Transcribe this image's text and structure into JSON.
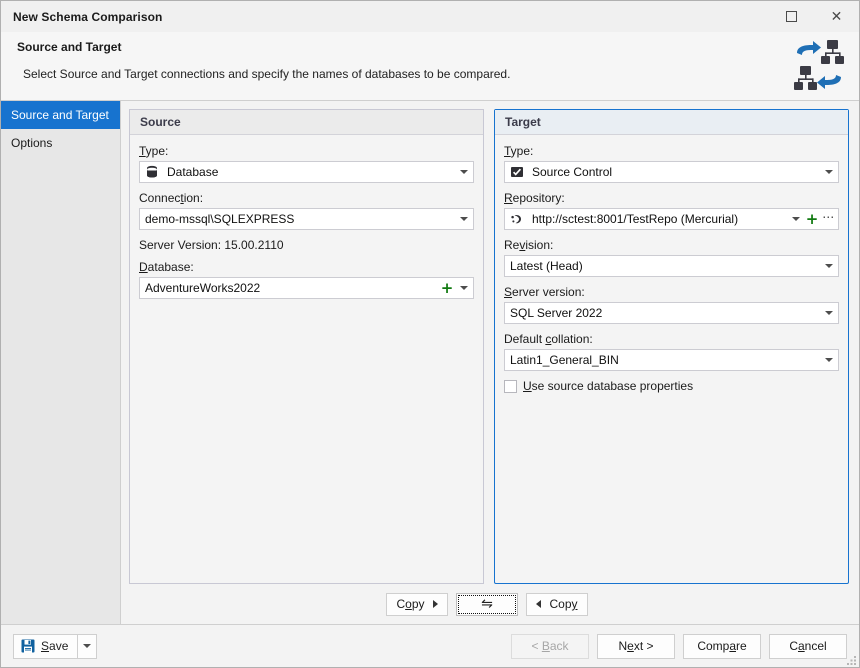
{
  "window": {
    "title": "New Schema Comparison",
    "maximize_icon": "maximize-square-icon",
    "close_icon": "close-x-icon",
    "close_glyph": "✕"
  },
  "header": {
    "title": "Source and Target",
    "description": "Select Source and Target connections and specify the names of databases to be compared.",
    "logo_icon": "schema-comparison-logo-icon"
  },
  "sidebar": {
    "items": [
      {
        "label": "Source and Target",
        "active": true
      },
      {
        "label": "Options",
        "active": false
      }
    ]
  },
  "source_panel": {
    "title": "Source",
    "type": {
      "label": "Type:",
      "label_pre": "T",
      "label_post": "ype:",
      "value": "Database",
      "icon": "database-cylinder-icon"
    },
    "connection": {
      "label_pre": "Connec",
      "label_mid": "t",
      "label_post": "ion:",
      "value": "demo-mssql\\SQLEXPRESS"
    },
    "server_version": "Server Version: 15.00.2110",
    "database": {
      "label_pre": "D",
      "label_mid": "a",
      "label_post": "tabase:",
      "value": "AdventureWorks2022",
      "add_glyph": "+"
    }
  },
  "target_panel": {
    "title": "Target",
    "type": {
      "label_pre": "T",
      "label_post": "ype:",
      "value": "Source Control",
      "icon": "source-control-check-icon"
    },
    "repository": {
      "label_pre": "R",
      "label_post": "epository:",
      "value": "http://sctest:8001/TestRepo (Mercurial)",
      "icon": "mercurial-repo-icon",
      "add_glyph": "+",
      "more_glyph": "⋯"
    },
    "revision": {
      "label_pre": "Re",
      "label_mid": "v",
      "label_post": "ision:",
      "value": "Latest (Head)"
    },
    "server_version": {
      "label_pre": "S",
      "label_post": "erver version:",
      "value": "SQL Server 2022"
    },
    "default_collation": {
      "label_pre": "Default ",
      "label_mid": "c",
      "label_post": "ollation:",
      "value": "Latin1_General_BIN"
    },
    "use_source_db_props": {
      "label_pre": "U",
      "label_post": "se source database properties",
      "checked": false
    }
  },
  "copy_row": {
    "copy_right": {
      "label_pre": "C",
      "label_mid": "o",
      "label_post": "py",
      "arrow": "triangle-right"
    },
    "swap": {
      "glyph": "⇋",
      "icon": "swap-arrows-icon"
    },
    "copy_left": {
      "label_pre": "Cop",
      "label_mid": "y",
      "label_post": "",
      "arrow": "triangle-left"
    }
  },
  "footer": {
    "save": {
      "label_pre": "S",
      "label_post": "ave",
      "icon": "floppy-save-icon"
    },
    "back": {
      "label_pre": "< ",
      "label_mid": "B",
      "label_post": "ack",
      "disabled": true
    },
    "next": {
      "label_pre": "N",
      "label_mid": "e",
      "label_post": "xt >",
      "disabled": false
    },
    "compare": {
      "label_pre": "Comp",
      "label_mid": "a",
      "label_post": "re",
      "disabled": false
    },
    "cancel": {
      "label_pre": "C",
      "label_mid": "a",
      "label_post": "ncel",
      "disabled": false
    }
  },
  "colors": {
    "accent": "#1773cf",
    "sidebar_selected_bg": "#1773cf",
    "add_green": "#117a11",
    "logo_blue": "#1f6fb5",
    "logo_dark": "#3b3b44"
  }
}
